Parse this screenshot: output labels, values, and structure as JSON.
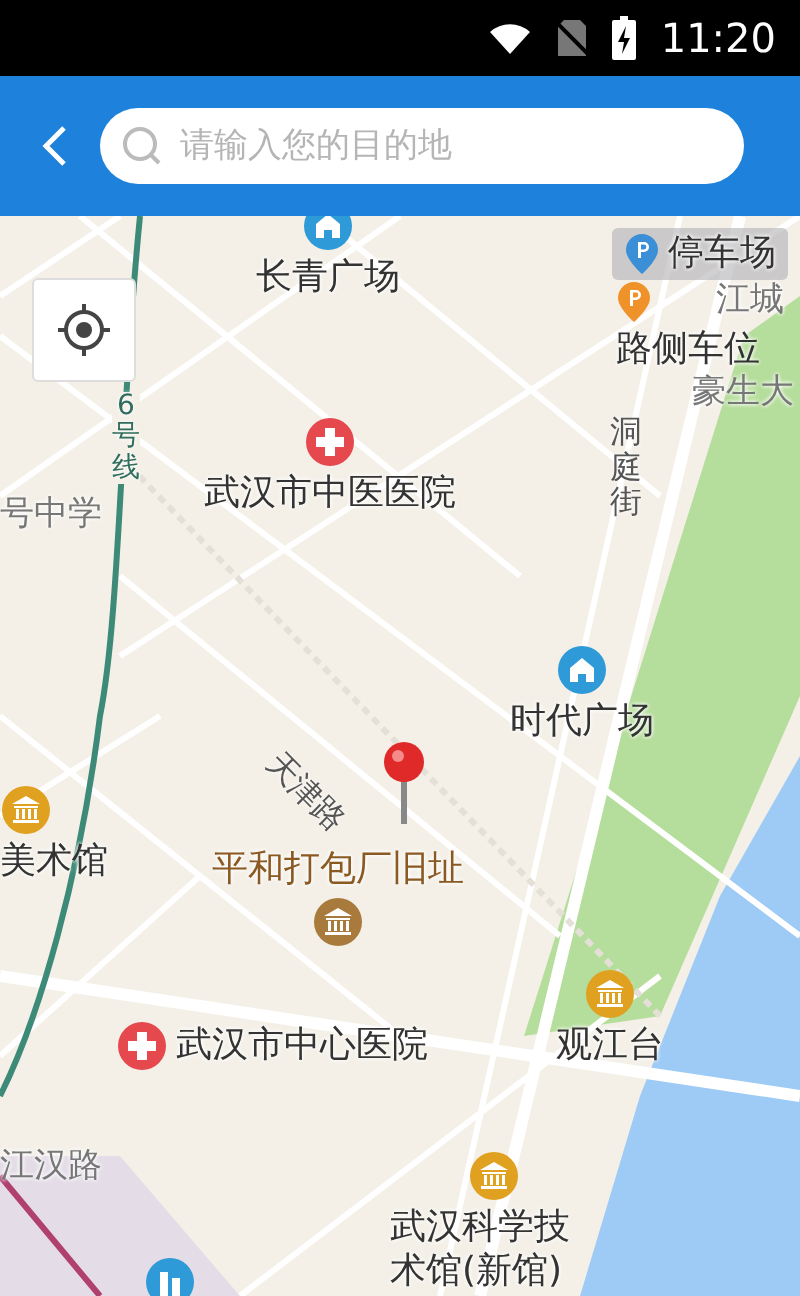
{
  "status_bar": {
    "time": "11:20"
  },
  "search": {
    "placeholder": "请输入您的目的地"
  },
  "places": [
    {
      "name": "长青广场",
      "kind": "plaza"
    },
    {
      "name": "停车场",
      "kind": "parking"
    },
    {
      "name": "江城",
      "kind": "label"
    },
    {
      "name": "路侧车位",
      "kind": "roadside-parking"
    },
    {
      "name": "豪生大",
      "kind": "label"
    },
    {
      "name": "武汉市中医医院",
      "kind": "hospital"
    },
    {
      "name": "号中学",
      "kind": "label"
    },
    {
      "name": "时代广场",
      "kind": "plaza"
    },
    {
      "name": "美术馆",
      "kind": "museum"
    },
    {
      "name": "平和打包厂旧址",
      "kind": "landmark"
    },
    {
      "name": "武汉市中心医院",
      "kind": "hospital"
    },
    {
      "name": "观江台",
      "kind": "museum"
    },
    {
      "name": "江汉路",
      "kind": "label"
    },
    {
      "name": "武汉科学技术馆(新馆)",
      "kind": "museum"
    }
  ],
  "roads": [
    {
      "name": "洞庭街",
      "kind": "vertical"
    },
    {
      "name": "6号线",
      "kind": "vertical-line"
    },
    {
      "name": "天津路",
      "kind": "diagonal"
    }
  ]
}
